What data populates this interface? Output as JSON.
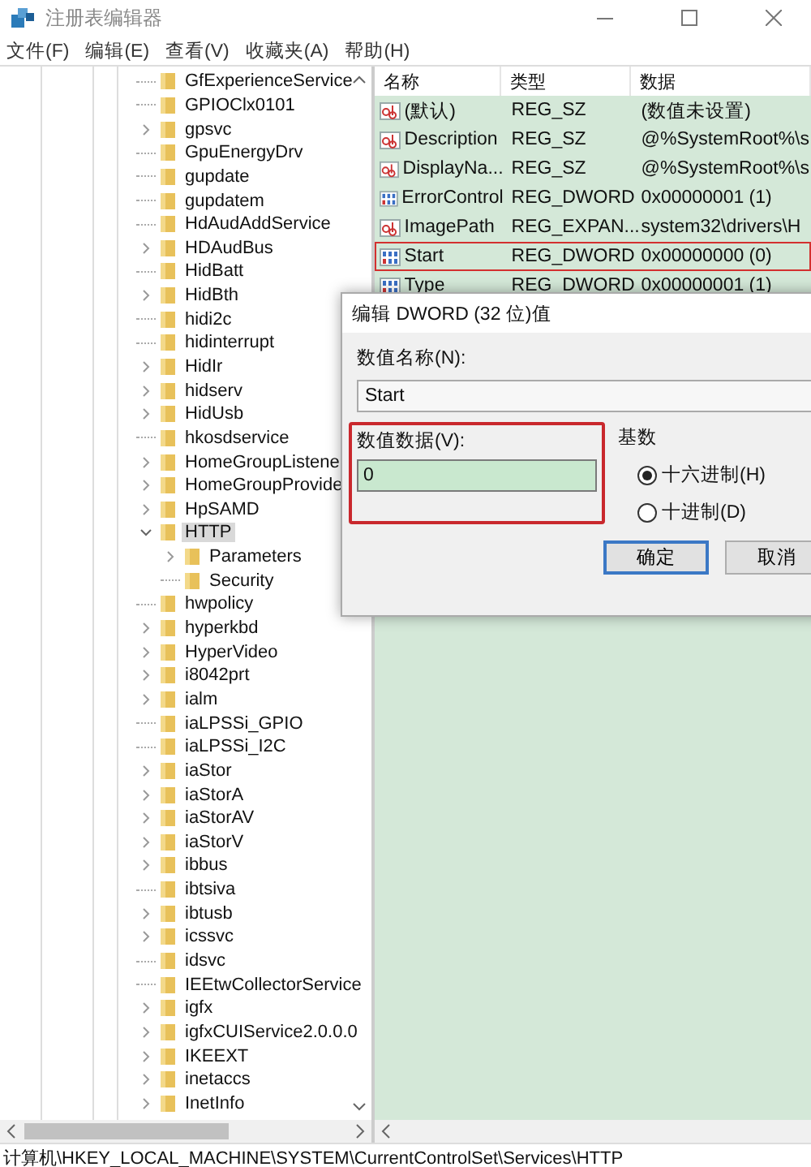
{
  "window": {
    "title": "注册表编辑器"
  },
  "menu": [
    {
      "label": "文件(F)"
    },
    {
      "label": "编辑(E)"
    },
    {
      "label": "查看(V)"
    },
    {
      "label": "收藏夹(A)"
    },
    {
      "label": "帮助(H)"
    }
  ],
  "tree": {
    "items": [
      {
        "label": "GfExperienceService",
        "kind": "leaf",
        "selected": false
      },
      {
        "label": "GPIOClx0101",
        "kind": "leaf",
        "selected": false
      },
      {
        "label": "gpsvc",
        "kind": "collapsed",
        "selected": false
      },
      {
        "label": "GpuEnergyDrv",
        "kind": "leaf",
        "selected": false
      },
      {
        "label": "gupdate",
        "kind": "leaf",
        "selected": false
      },
      {
        "label": "gupdatem",
        "kind": "leaf",
        "selected": false
      },
      {
        "label": "HdAudAddService",
        "kind": "leaf",
        "selected": false
      },
      {
        "label": "HDAudBus",
        "kind": "collapsed",
        "selected": false
      },
      {
        "label": "HidBatt",
        "kind": "leaf",
        "selected": false
      },
      {
        "label": "HidBth",
        "kind": "collapsed",
        "selected": false
      },
      {
        "label": "hidi2c",
        "kind": "leaf",
        "selected": false
      },
      {
        "label": "hidinterrupt",
        "kind": "leaf",
        "selected": false
      },
      {
        "label": "HidIr",
        "kind": "collapsed",
        "selected": false
      },
      {
        "label": "hidserv",
        "kind": "collapsed",
        "selected": false
      },
      {
        "label": "HidUsb",
        "kind": "collapsed",
        "selected": false
      },
      {
        "label": "hkosdservice",
        "kind": "leaf",
        "selected": false
      },
      {
        "label": "HomeGroupListene",
        "kind": "collapsed",
        "selected": false
      },
      {
        "label": "HomeGroupProvide",
        "kind": "collapsed",
        "selected": false
      },
      {
        "label": "HpSAMD",
        "kind": "collapsed",
        "selected": false
      },
      {
        "label": "HTTP",
        "kind": "expanded",
        "selected": true,
        "children": [
          {
            "label": "Parameters",
            "kind": "collapsed",
            "selected": false
          },
          {
            "label": "Security",
            "kind": "leaf",
            "selected": false
          }
        ]
      },
      {
        "label": "hwpolicy",
        "kind": "leaf",
        "selected": false
      },
      {
        "label": "hyperkbd",
        "kind": "collapsed",
        "selected": false
      },
      {
        "label": "HyperVideo",
        "kind": "collapsed",
        "selected": false
      },
      {
        "label": "i8042prt",
        "kind": "collapsed",
        "selected": false
      },
      {
        "label": "ialm",
        "kind": "collapsed",
        "selected": false
      },
      {
        "label": "iaLPSSi_GPIO",
        "kind": "leaf",
        "selected": false
      },
      {
        "label": "iaLPSSi_I2C",
        "kind": "leaf",
        "selected": false
      },
      {
        "label": "iaStor",
        "kind": "collapsed",
        "selected": false
      },
      {
        "label": "iaStorA",
        "kind": "collapsed",
        "selected": false
      },
      {
        "label": "iaStorAV",
        "kind": "collapsed",
        "selected": false
      },
      {
        "label": "iaStorV",
        "kind": "collapsed",
        "selected": false
      },
      {
        "label": "ibbus",
        "kind": "collapsed",
        "selected": false
      },
      {
        "label": "ibtsiva",
        "kind": "leaf",
        "selected": false
      },
      {
        "label": "ibtusb",
        "kind": "collapsed",
        "selected": false
      },
      {
        "label": "icssvc",
        "kind": "collapsed",
        "selected": false
      },
      {
        "label": "idsvc",
        "kind": "leaf",
        "selected": false
      },
      {
        "label": "IEEtwCollectorService",
        "kind": "leaf",
        "selected": false
      },
      {
        "label": "igfx",
        "kind": "collapsed",
        "selected": false
      },
      {
        "label": "igfxCUIService2.0.0.0",
        "kind": "collapsed",
        "selected": false
      },
      {
        "label": "IKEEXT",
        "kind": "collapsed",
        "selected": false
      },
      {
        "label": "inetaccs",
        "kind": "collapsed",
        "selected": false
      },
      {
        "label": "InetInfo",
        "kind": "collapsed",
        "selected": false
      }
    ]
  },
  "values": {
    "columns": [
      "名称",
      "类型",
      "数据"
    ],
    "rows": [
      {
        "name": "(默认)",
        "type": "REG_SZ",
        "data": "(数值未设置)",
        "kind": "string",
        "highlighted": false
      },
      {
        "name": "Description",
        "type": "REG_SZ",
        "data": "@%SystemRoot%\\s",
        "kind": "string",
        "highlighted": false
      },
      {
        "name": "DisplayNa...",
        "type": "REG_SZ",
        "data": "@%SystemRoot%\\s",
        "kind": "string",
        "highlighted": false
      },
      {
        "name": "ErrorControl",
        "type": "REG_DWORD",
        "data": "0x00000001 (1)",
        "kind": "binary",
        "highlighted": false
      },
      {
        "name": "ImagePath",
        "type": "REG_EXPAN...",
        "data": "system32\\drivers\\H",
        "kind": "string",
        "highlighted": false
      },
      {
        "name": "Start",
        "type": "REG_DWORD",
        "data": "0x00000000 (0)",
        "kind": "binary",
        "highlighted": true
      },
      {
        "name": "Type",
        "type": "REG_DWORD",
        "data": "0x00000001 (1)",
        "kind": "binary",
        "highlighted": false
      }
    ]
  },
  "dialog": {
    "title": "编辑 DWORD (32 位)值",
    "name_label": "数值名称(N):",
    "name_value": "Start",
    "data_label": "数值数据(V):",
    "data_value": "0",
    "data_highlighted": true,
    "base_label": "基数",
    "radios": [
      {
        "label": "十六进制(H)",
        "selected": true
      },
      {
        "label": "十进制(D)",
        "selected": false
      }
    ],
    "buttons": [
      {
        "label": "确定",
        "kind": "default"
      },
      {
        "label": "取消",
        "kind": "normal"
      }
    ]
  },
  "status_bar": "计算机\\HKEY_LOCAL_MACHINE\\SYSTEM\\CurrentControlSet\\Services\\HTTP"
}
